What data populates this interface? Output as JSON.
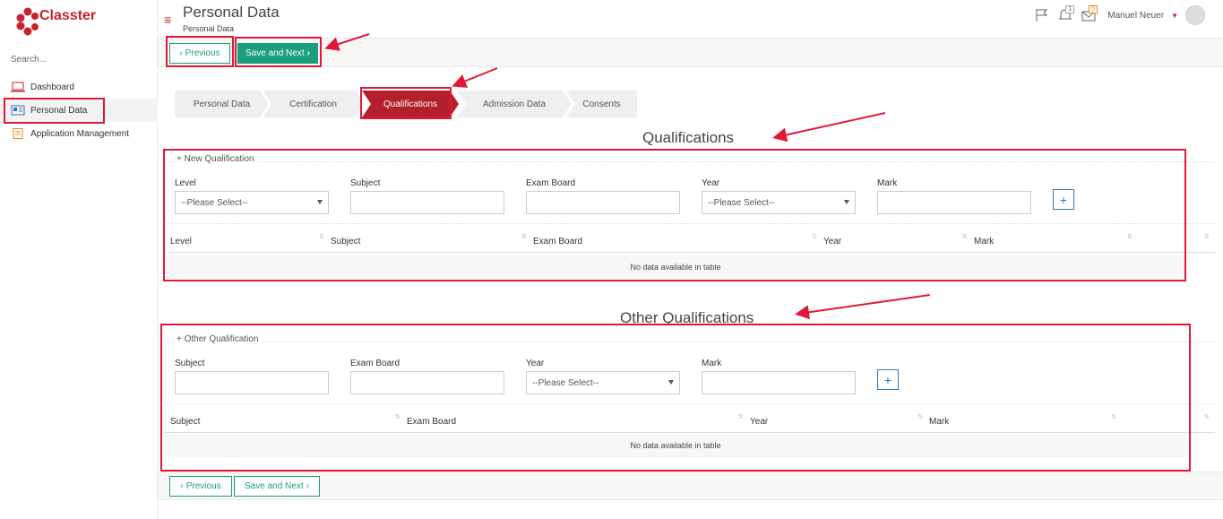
{
  "app": {
    "name": "Classter",
    "brand_color": "#c8232c",
    "accent_color": "#1a9e7e"
  },
  "sidebar": {
    "search_placeholder": "Search...",
    "items": [
      {
        "label": "Dashboard",
        "icon": "laptop-icon"
      },
      {
        "label": "Personal Data",
        "icon": "id-card-icon",
        "active": true
      },
      {
        "label": "Application Management",
        "icon": "document-icon"
      }
    ]
  },
  "header": {
    "title": "Personal Data",
    "subtitle": "Personal Data",
    "notifications_count": "1",
    "messages_count": "0",
    "user_name": "Manuel Neuer"
  },
  "actions": {
    "previous_label": "Previous",
    "save_next_label": "Save and Next"
  },
  "steps": [
    {
      "label": "Personal Data"
    },
    {
      "label": "Certification"
    },
    {
      "label": "Qualifications",
      "active": true
    },
    {
      "label": "Admission Data"
    },
    {
      "label": "Consents"
    }
  ],
  "qualifications": {
    "title": "Qualifications",
    "legend": "New Qualification",
    "fields": {
      "level_label": "Level",
      "level_value": "--Please Select--",
      "subject_label": "Subject",
      "exam_board_label": "Exam Board",
      "year_label": "Year",
      "year_value": "--Please Select--",
      "mark_label": "Mark"
    },
    "columns": [
      "Level",
      "Subject",
      "Exam Board",
      "Year",
      "Mark"
    ],
    "empty_text": "No data available in table"
  },
  "other_qualifications": {
    "title": "Other Qualifications",
    "legend": "Other Qualification",
    "fields": {
      "subject_label": "Subject",
      "exam_board_label": "Exam Board",
      "year_label": "Year",
      "year_value": "--Please Select--",
      "mark_label": "Mark"
    },
    "columns": [
      "Subject",
      "Exam Board",
      "Year",
      "Mark"
    ],
    "empty_text": "No data available in table"
  },
  "annotation_color": "#e2183a"
}
